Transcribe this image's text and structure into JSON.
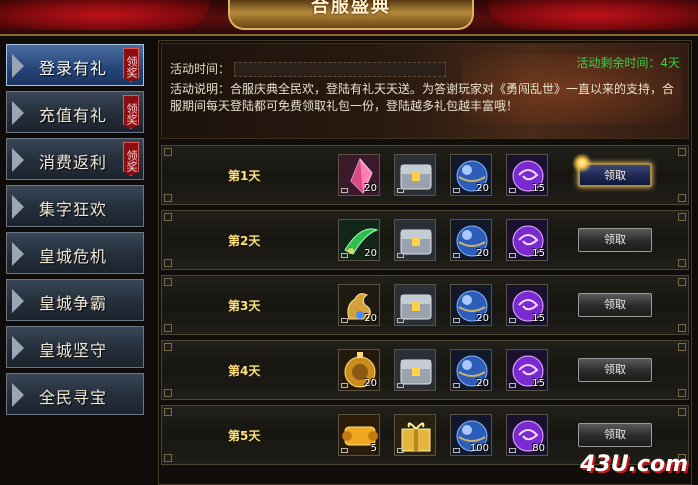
{
  "banner": {
    "title": "合服盛典"
  },
  "sidebar": {
    "items": [
      {
        "label": "登录有礼",
        "tag": "领奖",
        "active": true
      },
      {
        "label": "充值有礼",
        "tag": "领奖"
      },
      {
        "label": "消费返利",
        "tag": "领奖"
      },
      {
        "label": "集字狂欢"
      },
      {
        "label": "皇城危机"
      },
      {
        "label": "皇城争霸"
      },
      {
        "label": "皇城坚守"
      },
      {
        "label": "全民寻宝"
      }
    ]
  },
  "info": {
    "time_label": "活动时间：",
    "remaining": "活动剩余时间：4天",
    "description": "活动说明：合服庆典全民欢，登陆有礼天天送。为答谢玩家对《勇闯乱世》一直以来的支持，合服期间每天登陆都可免费领取礼包一份，登陆越多礼包越丰富哦！"
  },
  "rows": [
    {
      "day": "第1天",
      "button": "领取",
      "active": true,
      "items": [
        {
          "icon": "pink-crystal-icon",
          "count": "20"
        },
        {
          "icon": "treasure-chest-icon",
          "count": ""
        },
        {
          "icon": "blue-orb-icon",
          "count": "20"
        },
        {
          "icon": "purple-swirl-orb-icon",
          "count": "15"
        }
      ]
    },
    {
      "day": "第2天",
      "button": "领取",
      "items": [
        {
          "icon": "green-blade-icon",
          "count": "20"
        },
        {
          "icon": "treasure-chest-icon",
          "count": ""
        },
        {
          "icon": "blue-orb-icon",
          "count": "20"
        },
        {
          "icon": "purple-swirl-orb-icon",
          "count": "15"
        }
      ]
    },
    {
      "day": "第3天",
      "button": "领取",
      "items": [
        {
          "icon": "gold-dragon-icon",
          "count": "20"
        },
        {
          "icon": "treasure-chest-icon",
          "count": ""
        },
        {
          "icon": "blue-orb-icon",
          "count": "20"
        },
        {
          "icon": "purple-swirl-orb-icon",
          "count": "15"
        }
      ]
    },
    {
      "day": "第4天",
      "button": "领取",
      "items": [
        {
          "icon": "gold-medallion-icon",
          "count": "20"
        },
        {
          "icon": "treasure-chest-icon",
          "count": ""
        },
        {
          "icon": "blue-orb-icon",
          "count": "20"
        },
        {
          "icon": "purple-swirl-orb-icon",
          "count": "15"
        }
      ]
    },
    {
      "day": "第5天",
      "button": "领取",
      "items": [
        {
          "icon": "gold-scroll-icon",
          "count": "5"
        },
        {
          "icon": "gold-gift-box-icon",
          "count": ""
        },
        {
          "icon": "blue-orb-icon",
          "count": "100"
        },
        {
          "icon": "purple-swirl-orb-icon",
          "count": "80"
        }
      ]
    }
  ],
  "watermark": "43U.com"
}
